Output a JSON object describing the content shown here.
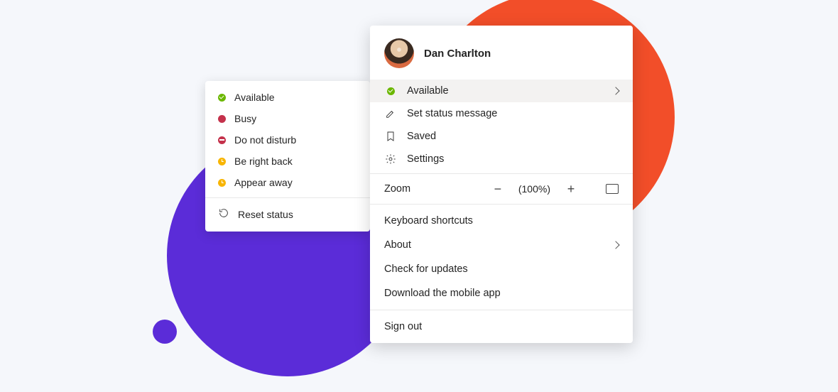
{
  "status_submenu": {
    "items": [
      {
        "label": "Available",
        "kind": "avail"
      },
      {
        "label": "Busy",
        "kind": "busy"
      },
      {
        "label": "Do not disturb",
        "kind": "dnd"
      },
      {
        "label": "Be right back",
        "kind": "brb"
      },
      {
        "label": "Appear away",
        "kind": "away"
      }
    ],
    "reset_label": "Reset status"
  },
  "profile": {
    "name": "Dan Charlton"
  },
  "menu": {
    "status_label": "Available",
    "set_status_label": "Set status message",
    "saved_label": "Saved",
    "settings_label": "Settings"
  },
  "zoom": {
    "label": "Zoom",
    "minus": "−",
    "plus": "+",
    "value": "(100%)"
  },
  "section2": {
    "keyboard_shortcuts": "Keyboard shortcuts",
    "about": "About",
    "check_updates": "Check for updates",
    "download_mobile": "Download the mobile app"
  },
  "signout_label": "Sign out"
}
